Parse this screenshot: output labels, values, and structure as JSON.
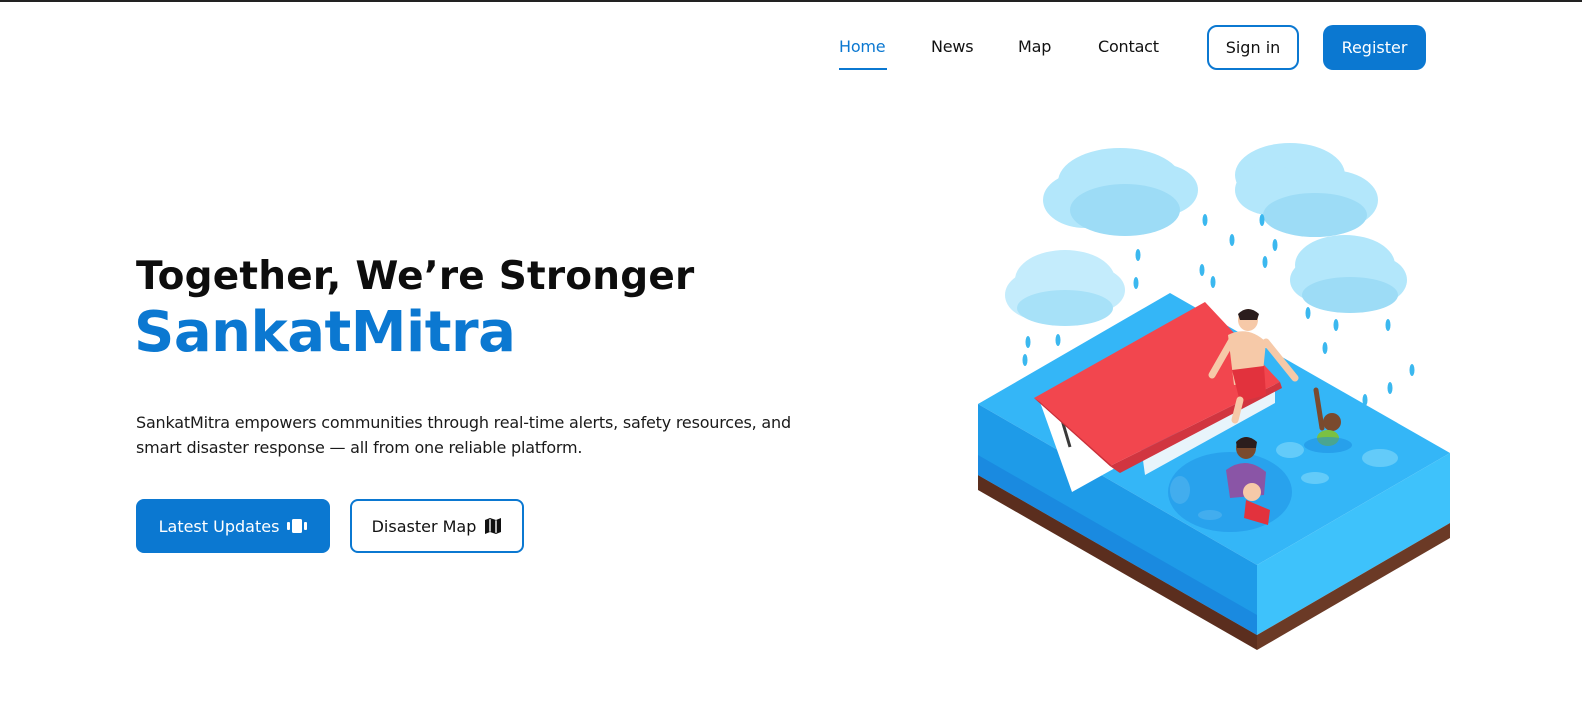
{
  "nav": {
    "links": [
      {
        "label": "Home",
        "active": true
      },
      {
        "label": "News",
        "active": false
      },
      {
        "label": "Map",
        "active": false
      },
      {
        "label": "Contact",
        "active": false
      }
    ],
    "signin_label": "Sign in",
    "register_label": "Register"
  },
  "hero": {
    "heading": "Together, We’re Stronger",
    "brand": "SankatMitra",
    "description": "SankatMitra empowers communities through real-time alerts, safety resources, and smart disaster response — all from one reliable platform.",
    "buttons": {
      "updates_label": "Latest Updates",
      "updates_icon": "carousel-icon",
      "map_label": "Disaster Map",
      "map_icon": "map-icon"
    }
  },
  "illustration": {
    "subject": "flood-rescue-isometric-illustration"
  },
  "colors": {
    "accent": "#0b78d1",
    "roof": "#f2464e",
    "water": "#34b6f7",
    "cloud": "#b3e7fb",
    "soil": "#5b2e1e"
  }
}
